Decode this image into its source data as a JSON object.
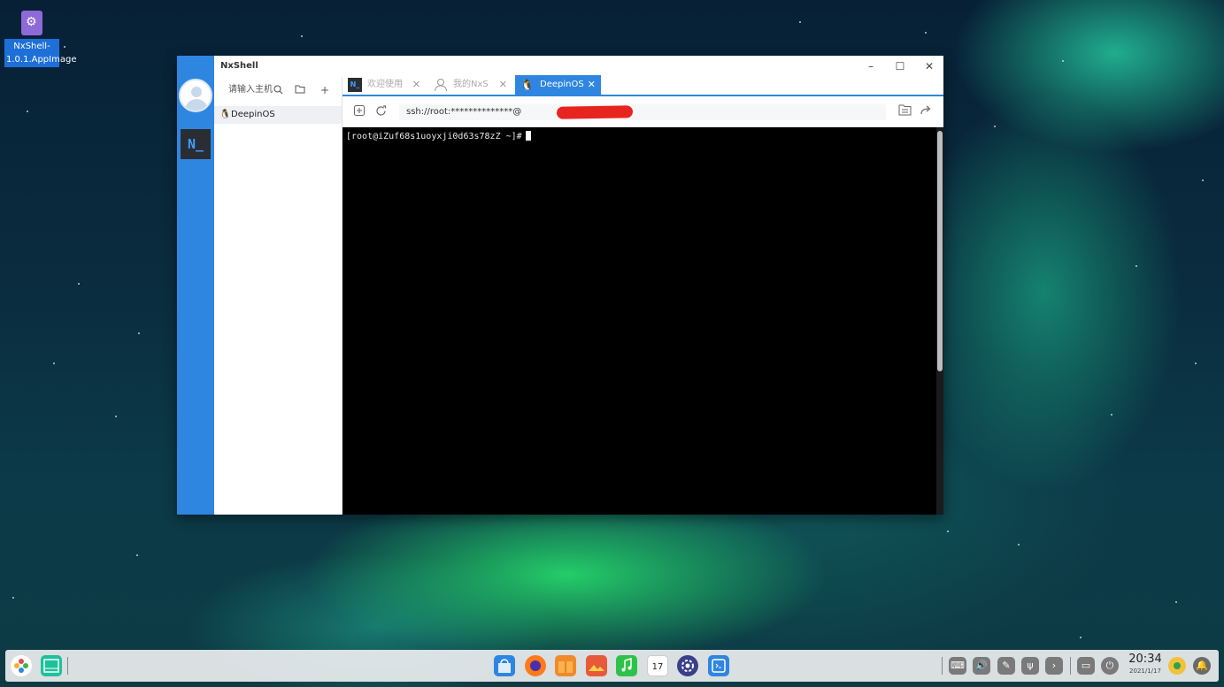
{
  "desktop": {
    "icon_label": "NxShell-1.0.1.AppImage"
  },
  "window": {
    "title": "NxShell",
    "minimize": "–",
    "maximize": "☐",
    "close": "✕"
  },
  "sidebar": {
    "search_placeholder": "请输入主机",
    "hosts": [
      {
        "label": "DeepinOS"
      }
    ]
  },
  "tabs": [
    {
      "label": "欢迎使用",
      "active": false
    },
    {
      "label": "我的NxS",
      "active": false
    },
    {
      "label": "DeepinOS",
      "active": true
    }
  ],
  "address_bar": {
    "value": "ssh://root:**************@"
  },
  "terminal": {
    "prompt": "[root@iZuf68s1uoyxji0d63s78zZ ~]#"
  },
  "taskbar": {
    "time": "20:34",
    "date": "2021/1/17",
    "calendar_day": "17"
  },
  "colors": {
    "accent": "#2f86e0",
    "terminal_bg": "#000000",
    "redaction": "#e8241e"
  }
}
